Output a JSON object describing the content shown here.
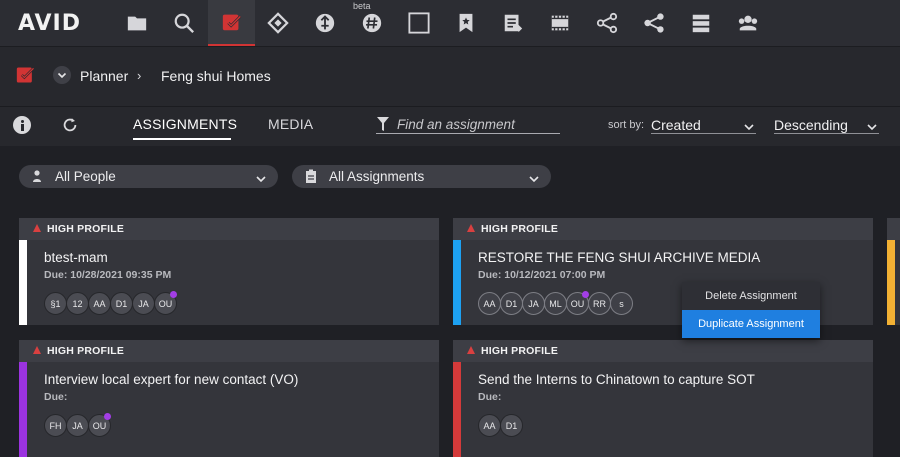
{
  "app": {
    "logo": "AVID"
  },
  "toolbar": {
    "beta_label": "beta",
    "icons": [
      "folder-icon",
      "search-icon",
      "planner-icon",
      "connect-icon",
      "pipeline-icon",
      "hashtag-icon",
      "square-icon",
      "bookmark-icon",
      "notes-icon",
      "film-icon",
      "share-node-icon",
      "share-icon",
      "server-icon",
      "users-icon"
    ],
    "active_index": 2,
    "accent": "#d13434"
  },
  "breadcrumb": {
    "root": "Planner",
    "current": "Feng shui Homes"
  },
  "tabs": [
    {
      "label": "ASSIGNMENTS"
    },
    {
      "label": "MEDIA"
    }
  ],
  "search": {
    "placeholder": "Find an assignment"
  },
  "sort": {
    "label": "sort by:",
    "field": "Created",
    "order": "Descending"
  },
  "filters": {
    "people": "All People",
    "assignments": "All Assignments"
  },
  "cards": [
    {
      "badge": "HIGH PROFILE",
      "title": "btest-mam",
      "due": "Due: 10/28/2021 09:35 PM",
      "stripe": "#ffffff",
      "avatars": [
        "§1",
        "12",
        "AA",
        "D1",
        "JA",
        "OU"
      ],
      "dot_on": "OU"
    },
    {
      "badge": "HIGH PROFILE",
      "title": "RESTORE THE FENG SHUI ARCHIVE MEDIA",
      "due": "Due: 10/12/2021 07:00 PM",
      "stripe": "#1da1f2",
      "avatars": [
        "AA",
        "D1",
        "JA",
        "ML",
        "OU",
        "RR",
        "s"
      ],
      "dot_on": "OU"
    },
    {
      "badge": "HIGH PROFILE",
      "title": "Interview local expert for new contact (VO)",
      "due": "Due:",
      "stripe": "#9b33e0",
      "avatars": [
        "FH",
        "JA",
        "OU"
      ],
      "dot_on": "OU"
    },
    {
      "badge": "HIGH PROFILE",
      "title": "Send the Interns to Chinatown to capture SOT",
      "due": "Due:",
      "stripe": "#d43a3a",
      "avatars": [
        "AA",
        "D1"
      ],
      "dot_on": ""
    }
  ],
  "context_menu": {
    "items": [
      "Delete Assignment",
      "Duplicate Assignment"
    ],
    "highlight_color": "#1f7fe0"
  }
}
